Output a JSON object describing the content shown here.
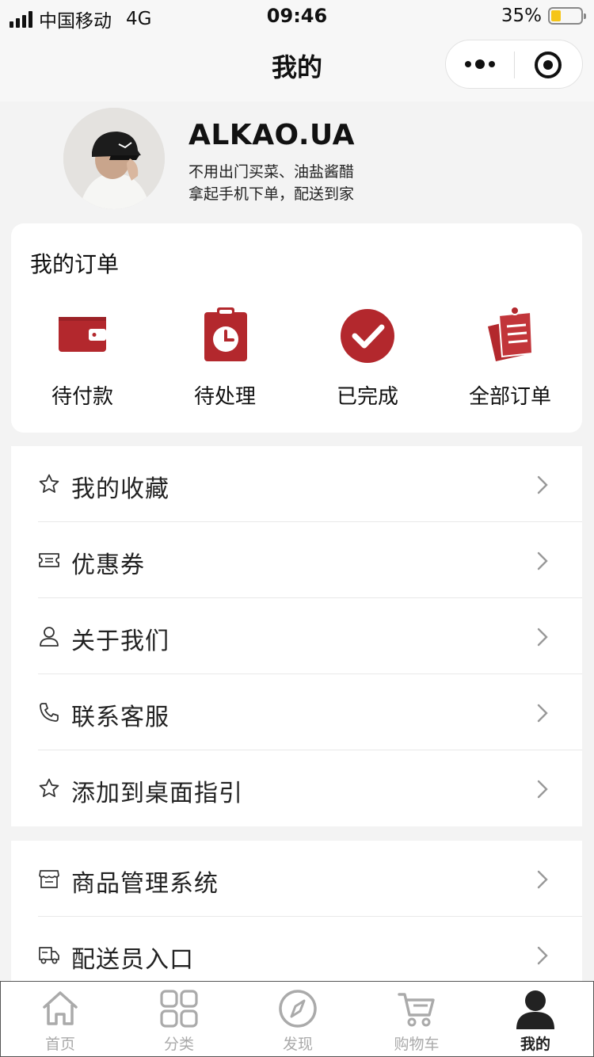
{
  "status_bar": {
    "carrier": "中国移动",
    "network": "4G",
    "time": "09:46",
    "battery": "35%"
  },
  "nav": {
    "title": "我的"
  },
  "profile": {
    "name": "ALKAO.UA",
    "line1": "不用出门买菜、油盐酱醋",
    "line2": "拿起手机下单，配送到家"
  },
  "orders": {
    "title": "我的订单",
    "items": [
      {
        "label": "待付款",
        "icon": "wallet-icon"
      },
      {
        "label": "待处理",
        "icon": "clipboard-clock-icon"
      },
      {
        "label": "已完成",
        "icon": "check-circle-icon"
      },
      {
        "label": "全部订单",
        "icon": "order-list-icon"
      }
    ]
  },
  "menu": {
    "group1": [
      {
        "label": "我的收藏",
        "icon": "star-icon"
      },
      {
        "label": "优惠券",
        "icon": "coupon-icon"
      },
      {
        "label": "关于我们",
        "icon": "user-icon"
      },
      {
        "label": "联系客服",
        "icon": "phone-icon"
      },
      {
        "label": "添加到桌面指引",
        "icon": "star-icon"
      }
    ],
    "group2": [
      {
        "label": "商品管理系统",
        "icon": "store-icon"
      },
      {
        "label": "配送员入口",
        "icon": "delivery-truck-icon"
      }
    ]
  },
  "tabbar": {
    "items": [
      {
        "label": "首页",
        "icon": "home-icon",
        "active": false
      },
      {
        "label": "分类",
        "icon": "grid-icon",
        "active": false
      },
      {
        "label": "发现",
        "icon": "compass-icon",
        "active": false
      },
      {
        "label": "购物车",
        "icon": "cart-icon",
        "active": false
      },
      {
        "label": "我的",
        "icon": "person-icon",
        "active": true
      }
    ]
  },
  "colors": {
    "accent": "#b3282d",
    "background": "#f3f3f3",
    "tab_inactive": "#aaaaaa",
    "tab_active": "#222222"
  }
}
